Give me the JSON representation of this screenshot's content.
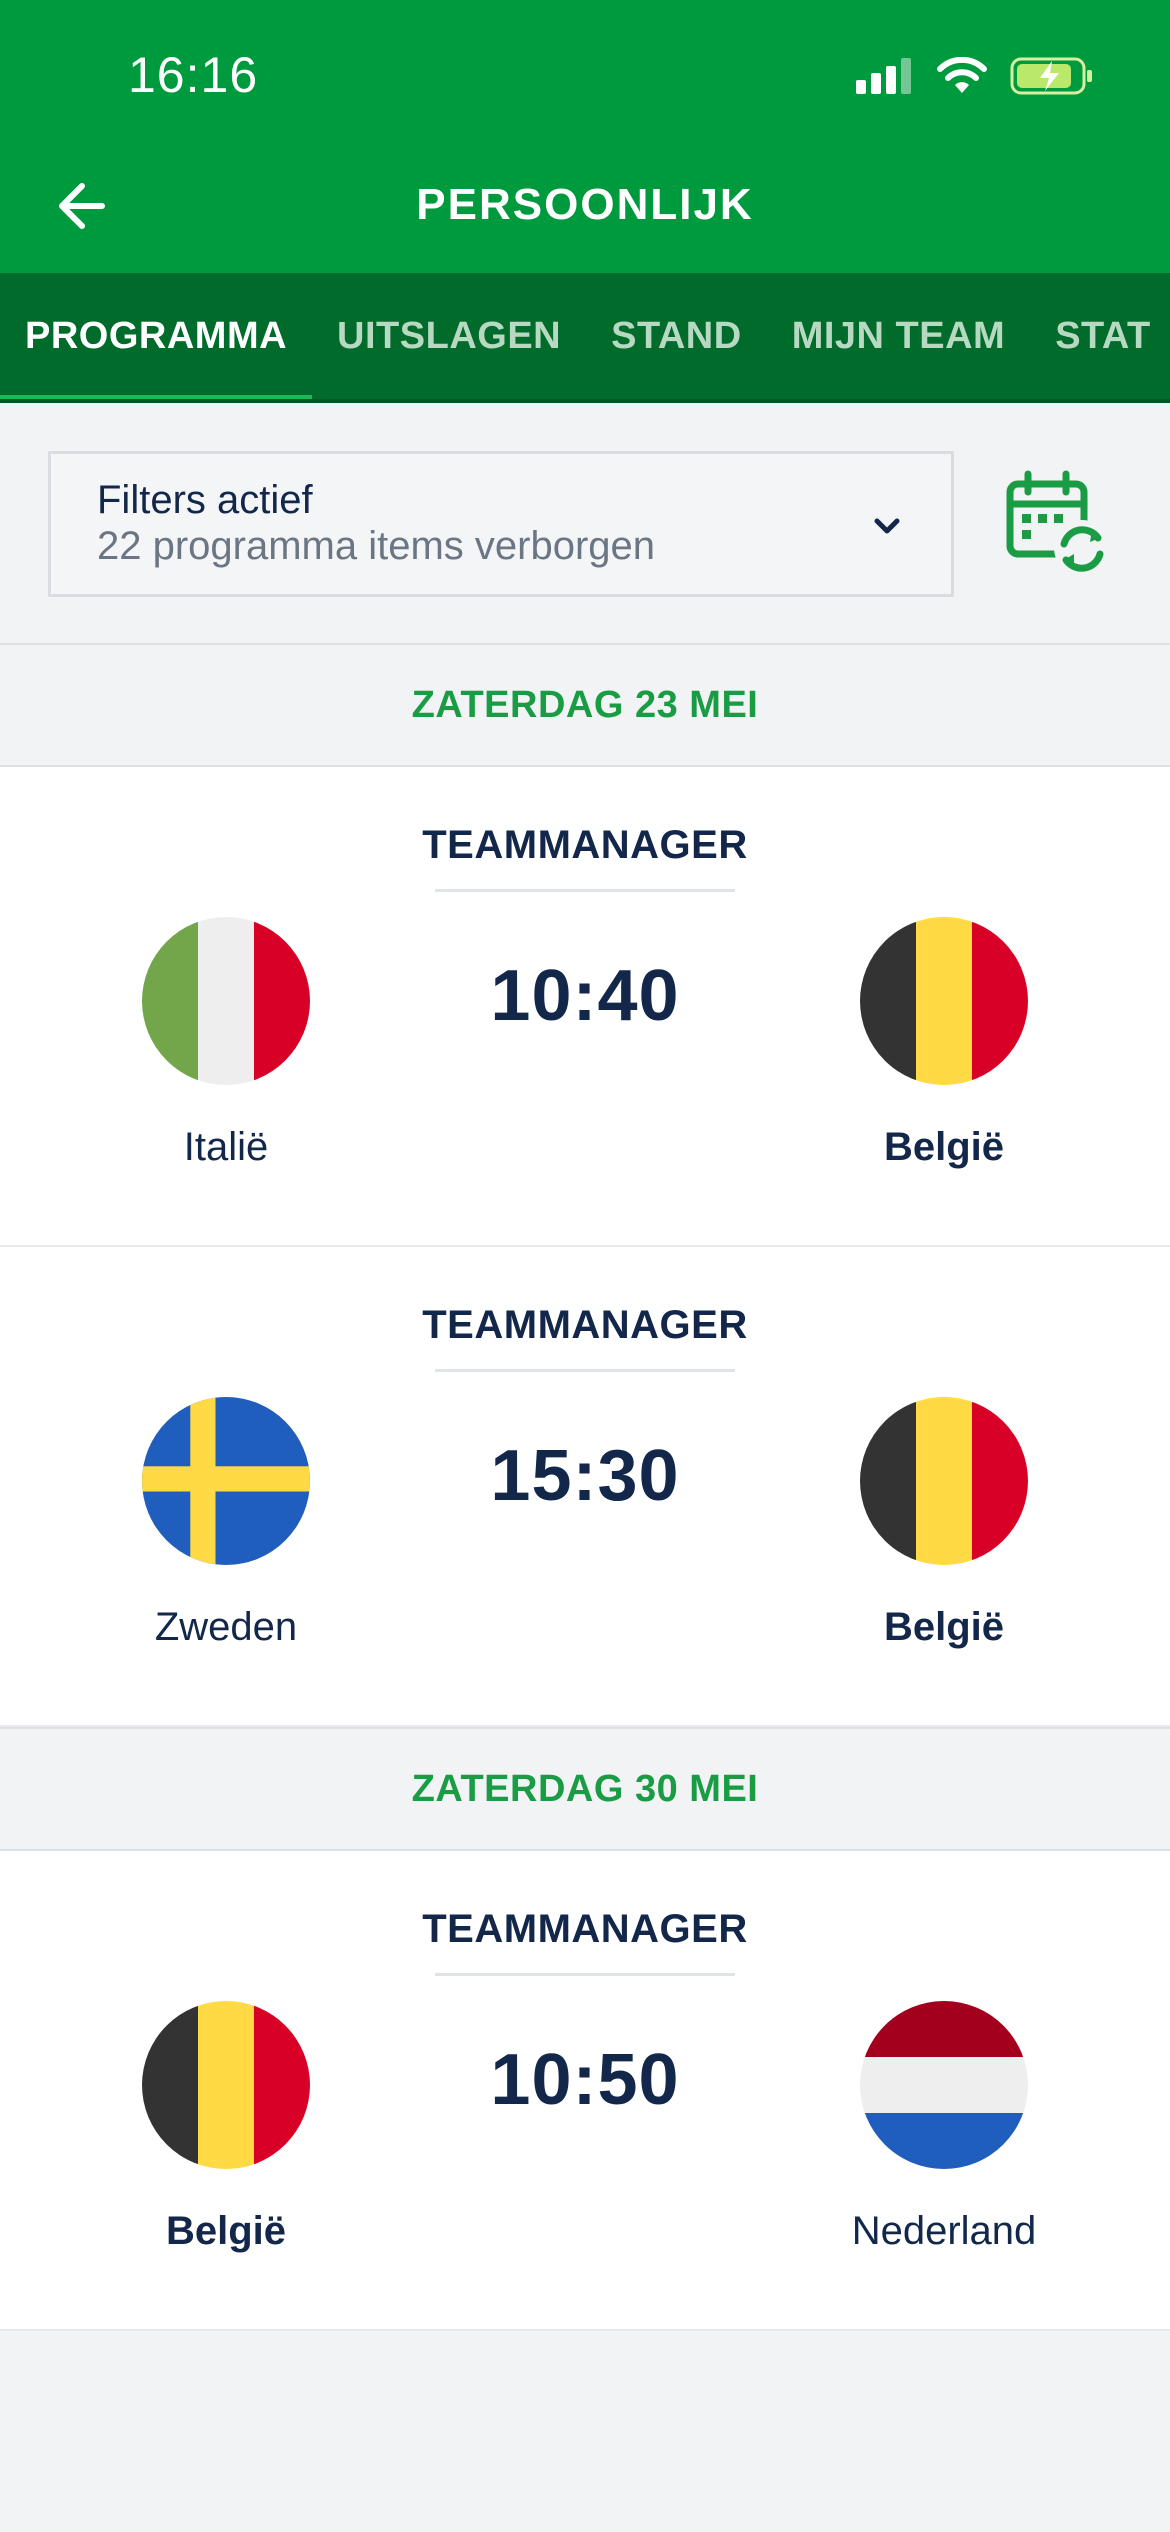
{
  "status_bar": {
    "time": "16:16"
  },
  "header": {
    "title": "PERSOONLIJK"
  },
  "tabs": [
    {
      "label": "PROGRAMMA",
      "active": true
    },
    {
      "label": "UITSLAGEN",
      "active": false
    },
    {
      "label": "STAND",
      "active": false
    },
    {
      "label": "MIJN TEAM",
      "active": false
    },
    {
      "label": "STAT",
      "active": false
    }
  ],
  "filter": {
    "title": "Filters actief",
    "subtitle": "22 programma items verborgen"
  },
  "days": [
    {
      "label": "ZATERDAG 23 MEI",
      "matches": [
        {
          "label": "TEAMMANAGER",
          "time": "10:40",
          "home": "Italië",
          "away": "België",
          "home_flag": "italy",
          "away_flag": "belgium"
        },
        {
          "label": "TEAMMANAGER",
          "time": "15:30",
          "home": "Zweden",
          "away": "België",
          "home_flag": "sweden",
          "away_flag": "belgium"
        }
      ]
    },
    {
      "label": "ZATERDAG 30 MEI",
      "matches": [
        {
          "label": "TEAMMANAGER",
          "time": "10:50",
          "home": "België",
          "away": "Nederland",
          "home_flag": "belgium",
          "away_flag": "netherlands"
        }
      ]
    }
  ],
  "colors": {
    "primary_green": "#009a3e",
    "dark_green": "#006b2a",
    "navy": "#13274a",
    "day_green": "#1a9c45"
  }
}
